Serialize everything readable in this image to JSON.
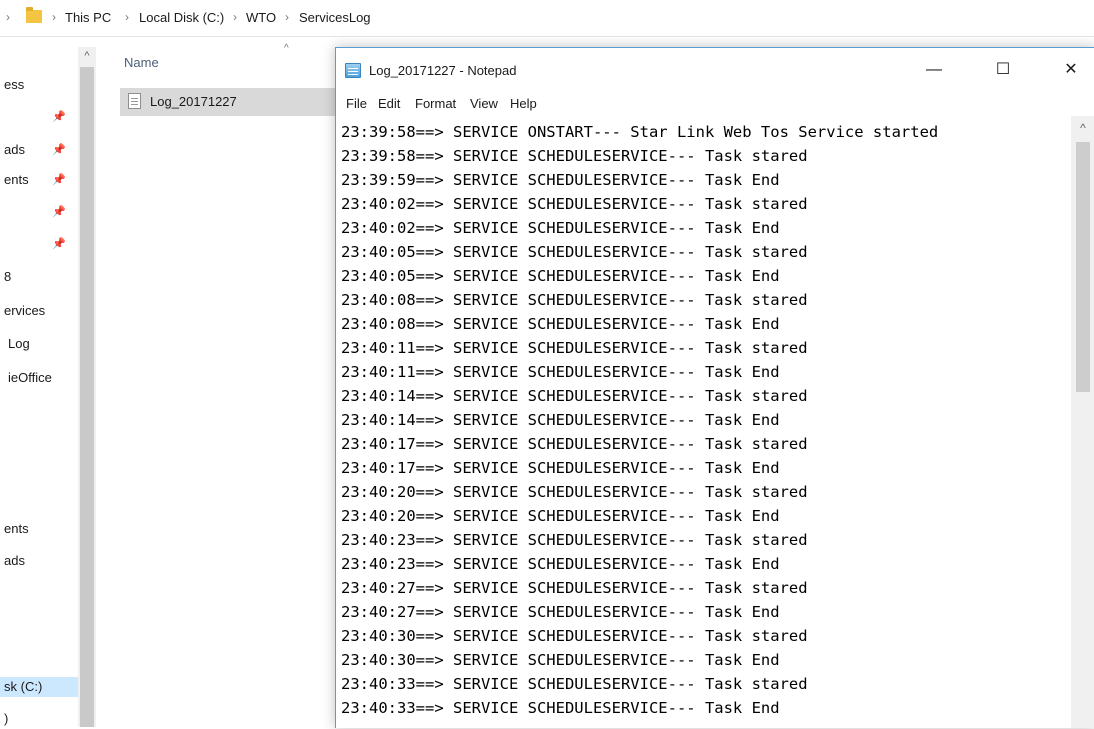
{
  "explorer": {
    "breadcrumb": [
      "This PC",
      "Local Disk (C:)",
      "WTO",
      "ServicesLog"
    ],
    "separator": "›",
    "nav_items": [
      {
        "label": "ess",
        "pinned": false
      },
      {
        "label": "",
        "pinned": true
      },
      {
        "label": "ads",
        "pinned": true
      },
      {
        "label": "ents",
        "pinned": true
      },
      {
        "label": "",
        "pinned": true
      },
      {
        "label": "",
        "pinned": true
      },
      {
        "label": "8",
        "pinned": false
      },
      {
        "label": "ervices",
        "pinned": false
      },
      {
        "label": "Log",
        "pinned": false
      },
      {
        "label": "ieOffice",
        "pinned": false
      },
      {
        "label": "ents",
        "pinned": false
      },
      {
        "label": "ads",
        "pinned": false
      },
      {
        "label": "sk (C:)",
        "pinned": false
      },
      {
        "label": ")",
        "pinned": false
      }
    ],
    "column_header": "Name",
    "sort_indicator": "^",
    "files": [
      {
        "name": "Log_20171227",
        "selected": true
      }
    ]
  },
  "notepad": {
    "title": "Log_20171227 - Notepad",
    "controls": {
      "minimize": "—",
      "maximize": "☐",
      "close": "✕"
    },
    "menu": [
      "File",
      "Edit",
      "Format",
      "View",
      "Help"
    ],
    "lines": [
      "23:39:58==> SERVICE ONSTART--- Star Link Web Tos Service started",
      "23:39:58==> SERVICE SCHEDULESERVICE--- Task stared",
      "23:39:59==> SERVICE SCHEDULESERVICE--- Task End",
      "23:40:02==> SERVICE SCHEDULESERVICE--- Task stared",
      "23:40:02==> SERVICE SCHEDULESERVICE--- Task End",
      "23:40:05==> SERVICE SCHEDULESERVICE--- Task stared",
      "23:40:05==> SERVICE SCHEDULESERVICE--- Task End",
      "23:40:08==> SERVICE SCHEDULESERVICE--- Task stared",
      "23:40:08==> SERVICE SCHEDULESERVICE--- Task End",
      "23:40:11==> SERVICE SCHEDULESERVICE--- Task stared",
      "23:40:11==> SERVICE SCHEDULESERVICE--- Task End",
      "23:40:14==> SERVICE SCHEDULESERVICE--- Task stared",
      "23:40:14==> SERVICE SCHEDULESERVICE--- Task End",
      "23:40:17==> SERVICE SCHEDULESERVICE--- Task stared",
      "23:40:17==> SERVICE SCHEDULESERVICE--- Task End",
      "23:40:20==> SERVICE SCHEDULESERVICE--- Task stared",
      "23:40:20==> SERVICE SCHEDULESERVICE--- Task End",
      "23:40:23==> SERVICE SCHEDULESERVICE--- Task stared",
      "23:40:23==> SERVICE SCHEDULESERVICE--- Task End",
      "23:40:27==> SERVICE SCHEDULESERVICE--- Task stared",
      "23:40:27==> SERVICE SCHEDULESERVICE--- Task End",
      "23:40:30==> SERVICE SCHEDULESERVICE--- Task stared",
      "23:40:30==> SERVICE SCHEDULESERVICE--- Task End",
      "23:40:33==> SERVICE SCHEDULESERVICE--- Task stared",
      "23:40:33==> SERVICE SCHEDULESERVICE--- Task End"
    ],
    "scroll_up_glyph": "^"
  },
  "colors": {
    "selection": "#cce8ff",
    "file_selected": "#d9d9d9",
    "window_border": "#5a9bd5",
    "folder": "#f4c542"
  }
}
